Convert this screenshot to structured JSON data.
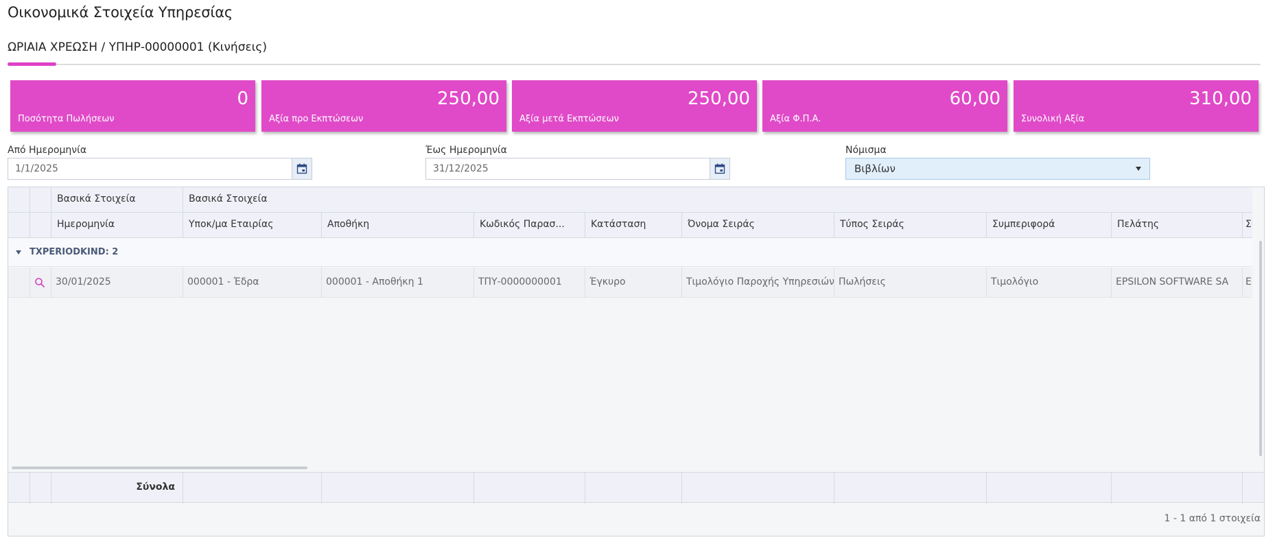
{
  "page": {
    "title": "Οικονομικά Στοιχεία Υπηρεσίας",
    "tab_title": "ΩΡΙΑΙΑ ΧΡΕΩΣΗ / ΥΠΗΡ-00000001 (Κινήσεις)"
  },
  "kpis": [
    {
      "value": "0",
      "label": "Ποσότητα Πωλήσεων"
    },
    {
      "value": "250,00",
      "label": "Αξία προ Εκπτώσεων"
    },
    {
      "value": "250,00",
      "label": "Αξία μετά Εκπτώσεων"
    },
    {
      "value": "60,00",
      "label": "Αξία Φ.Π.Α."
    },
    {
      "value": "310,00",
      "label": "Συνολική Αξία"
    }
  ],
  "filters": {
    "from_date": {
      "label": "Από Ημερομηνία",
      "value": "1/1/2025"
    },
    "to_date": {
      "label": "Έως Ημερομηνία",
      "value": "31/12/2025"
    },
    "currency": {
      "label": "Νόμισμα",
      "value": "Βιβλίων"
    }
  },
  "grid": {
    "band_headers": [
      "Βασικά Στοιχεία",
      "Βασικά Στοιχεία"
    ],
    "columns": [
      "Ημερομηνία",
      "Υποκ/μα Εταιρίας",
      "Αποθήκη",
      "Κωδικός Παρασ...",
      "Κατάσταση",
      "Όνομα Σειράς",
      "Τύπος Σειράς",
      "Συμπεριφορά",
      "Πελάτης",
      "Συνα"
    ],
    "group": {
      "label": "TXPERIODKIND: 2"
    },
    "rows": [
      {
        "cells": [
          "30/01/2025",
          "000001 - Έδρα",
          "000001 - Αποθήκη 1",
          "ΤΠΥ-0000000001",
          "Έγκυρο",
          "Τιμολόγιο Παροχής Υπηρεσιών",
          "Πωλήσεις",
          "Τιμολόγιο",
          "EPSILON SOFTWARE SA",
          "EPSI"
        ]
      }
    ],
    "totals_label": "Σύνολα",
    "pager": "1 - 1 από 1 στοιχεία"
  },
  "colors": {
    "accent": "#e04ac8",
    "select_bg": "#e1effb"
  }
}
